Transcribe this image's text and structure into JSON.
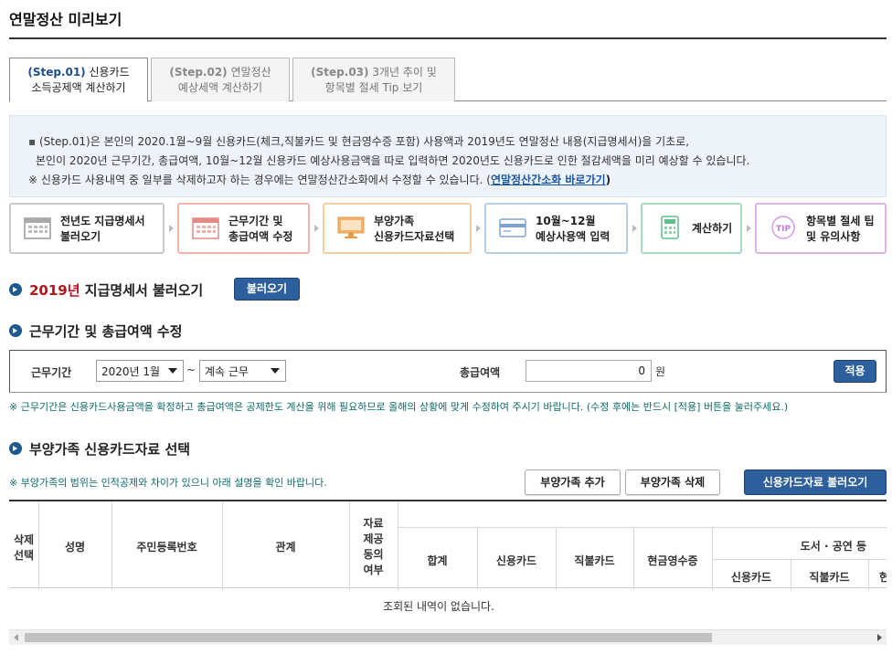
{
  "page_title": "연말정산 미리보기",
  "tabs": [
    {
      "step": "(Step.01)",
      "line1": "신용카드",
      "line2": "소득공제액 계산하기",
      "active": true
    },
    {
      "step": "(Step.02)",
      "line1": "연말정산",
      "line2": "예상세액 계산하기",
      "active": false
    },
    {
      "step": "(Step.03)",
      "line1": "3개년 추이 및",
      "line2": "항목별 절세 Tip 보기",
      "active": false
    }
  ],
  "info": {
    "line1": "(Step.01)은 본인의 2020.1월~9월 신용카드(체크,직불카드 및 현금영수증 포함) 사용액과 2019년도 연말정산 내용(지급명세서)을 기초로,",
    "line2": "본인이 2020년 근무기간, 총급여액, 10월~12월 신용카드 예상사용금액을 따로 입력하면 2020년도 신용카드로 인한 절감세액을 미리 예상할 수 있습니다.",
    "line3_prefix": "※ 신용카드 사용내역 중 일부를 삭제하고자 하는 경우에는 연말정산간소화에서 수정할 수 있습니다. (",
    "line3_link": "연말정산간소화 바로가기",
    "line3_suffix": ")"
  },
  "process_steps": [
    {
      "line1": "전년도 지급명세서",
      "line2": "불러오기",
      "icon": "calendar-icon",
      "color": "#c9c9c9"
    },
    {
      "line1": "근무기간 및",
      "line2": "총급여액 수정",
      "icon": "calendar-grid-icon",
      "color": "#f2b3b0"
    },
    {
      "line1": "부양가족",
      "line2": "신용카드자료선택",
      "icon": "monitor-icon",
      "color": "#f7cfa4"
    },
    {
      "line1": "10월~12월",
      "line2": "예상사용액 입력",
      "icon": "card-icon",
      "color": "#b9cdea"
    },
    {
      "line1": "계산하기",
      "line2": "",
      "icon": "calculator-icon",
      "color": "#a7dcc0"
    },
    {
      "line1": "항목별 절세 팁",
      "line2": "및 유의사항",
      "icon": "tip-icon",
      "color": "#d8b7e6"
    }
  ],
  "section1": {
    "year": "2019년",
    "title": " 지급명세서 불러오기",
    "button": "불러오기"
  },
  "section2": {
    "title": "근무기간 및 총급여액 수정",
    "period_label": "근무기간",
    "start_value": "2020년 1월",
    "tilde": "~",
    "end_value": "계속 근무",
    "salary_label": "총급여액",
    "salary_value": "0",
    "unit": "원",
    "apply_button": "적용",
    "note": "※ 근무기간은 신용카드사용금액을 확정하고 총급여액은 공제한도 계산을 위해 필요하므로 올해의 상황에 맞게 수정하여 주시기 바랍니다. (수정 후에는 반드시 [적용] 버튼을 눌러주세요.)"
  },
  "section3": {
    "title": "부양가족 신용카드자료 선택",
    "note": "※ 부양가족의 범위는 인적공제와 차이가 있으니 아래 설명을 확인 바랍니다.",
    "add_button": "부양가족 추가",
    "delete_button": "부양가족 삭제",
    "load_button": "신용카드자료 불러오기"
  },
  "table": {
    "col_delete": [
      "삭제",
      "선택"
    ],
    "col_name": "성명",
    "col_rrn": "주민등록번호",
    "col_relation": "관계",
    "col_provide": [
      "자료",
      "제공",
      "동의",
      "여부"
    ],
    "col_total": "합계",
    "col_credit": "신용카드",
    "col_debit": "직불카드",
    "col_cash": "현금영수증",
    "col_group": "도서 · 공연 등",
    "sub_credit": "신용카드",
    "sub_debit": "직불카드",
    "sub_cut": "현",
    "empty_text": "조회된 내역이 없습니다."
  }
}
